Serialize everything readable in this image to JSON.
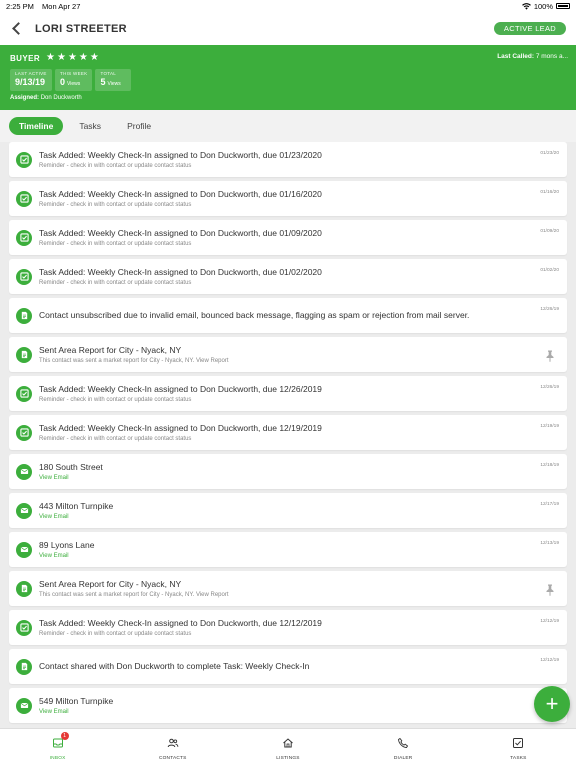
{
  "status_bar": {
    "time": "2:25 PM",
    "date": "Mon Apr 27",
    "battery": "100%"
  },
  "header": {
    "contact_name": "LORI STREETER",
    "lead_status": "ACTIVE LEAD"
  },
  "summary": {
    "role": "BUYER",
    "rating": 5,
    "last_called_label": "Last Called:",
    "last_called_value": "7 mons a...",
    "stats": [
      {
        "title": "LAST ACTIVE",
        "value": "9/13/19",
        "unit": ""
      },
      {
        "title": "THIS WEEK",
        "value": "0",
        "unit": "Views"
      },
      {
        "title": "TOTAL",
        "value": "5",
        "unit": "Views"
      }
    ],
    "assigned_label": "Assigned:",
    "assigned_value": "Don Duckworth"
  },
  "tabs": [
    {
      "label": "Timeline",
      "active": true
    },
    {
      "label": "Tasks",
      "active": false
    },
    {
      "label": "Profile",
      "active": false
    }
  ],
  "timeline": [
    {
      "type": "task",
      "title": "Task Added: Weekly Check-In assigned to Don Duckworth, due 01/23/2020",
      "subtitle": "Reminder - check in with contact or update contact status",
      "date": "01/23/20"
    },
    {
      "type": "task",
      "title": "Task Added: Weekly Check-In assigned to Don Duckworth, due 01/16/2020",
      "subtitle": "Reminder - check in with contact or update contact status",
      "date": "01/16/20"
    },
    {
      "type": "task",
      "title": "Task Added: Weekly Check-In assigned to Don Duckworth, due 01/09/2020",
      "subtitle": "Reminder - check in with contact or update contact status",
      "date": "01/09/20"
    },
    {
      "type": "task",
      "title": "Task Added: Weekly Check-In assigned to Don Duckworth, due 01/02/2020",
      "subtitle": "Reminder - check in with contact or update contact status",
      "date": "01/02/20"
    },
    {
      "type": "note",
      "title": "Contact unsubscribed due to invalid email, bounced back message, flagging as spam or rejection from mail server.",
      "subtitle": "",
      "date": "12/26/19"
    },
    {
      "type": "report",
      "title": "Sent Area Report for City - Nyack, NY",
      "subtitle": "This contact was sent a market report for City - Nyack, NY. View Report",
      "date": "",
      "pinned": true
    },
    {
      "type": "task",
      "title": "Task Added: Weekly Check-In assigned to Don Duckworth, due 12/26/2019",
      "subtitle": "Reminder - check in with contact or update contact status",
      "date": "12/26/19"
    },
    {
      "type": "task",
      "title": "Task Added: Weekly Check-In assigned to Don Duckworth, due 12/19/2019",
      "subtitle": "Reminder - check in with contact or update contact status",
      "date": "12/19/19"
    },
    {
      "type": "email",
      "title": "180 South Street",
      "subtitle": "View Email",
      "date": "12/18/19"
    },
    {
      "type": "email",
      "title": "443 Milton Turnpike",
      "subtitle": "View Email",
      "date": "12/17/19"
    },
    {
      "type": "email",
      "title": "89 Lyons Lane",
      "subtitle": "View Email",
      "date": "12/13/19"
    },
    {
      "type": "report",
      "title": "Sent Area Report for City - Nyack, NY",
      "subtitle": "This contact was sent a market report for City - Nyack, NY. View Report",
      "date": "",
      "pinned": true
    },
    {
      "type": "task",
      "title": "Task Added: Weekly Check-In assigned to Don Duckworth, due 12/12/2019",
      "subtitle": "Reminder - check in with contact or update contact status",
      "date": "12/12/19"
    },
    {
      "type": "note",
      "title": "Contact shared with Don Duckworth to complete Task: Weekly Check-In",
      "subtitle": "",
      "date": "12/12/19"
    },
    {
      "type": "email",
      "title": "549 Milton Turnpike",
      "subtitle": "View Email",
      "date": ""
    }
  ],
  "fab_label": "+",
  "bottom_tabs": [
    {
      "label": "INBOX",
      "icon": "inbox-icon",
      "badge": "1",
      "active": true
    },
    {
      "label": "CONTACTS",
      "icon": "contacts-icon",
      "badge": "",
      "active": false
    },
    {
      "label": "LISTINGS",
      "icon": "home-icon",
      "badge": "",
      "active": false
    },
    {
      "label": "DIALER",
      "icon": "phone-icon",
      "badge": "",
      "active": false
    },
    {
      "label": "TASKS",
      "icon": "tasks-icon",
      "badge": "",
      "active": false
    }
  ],
  "colors": {
    "accent": "#3cae3c",
    "badge": "#e53935"
  }
}
